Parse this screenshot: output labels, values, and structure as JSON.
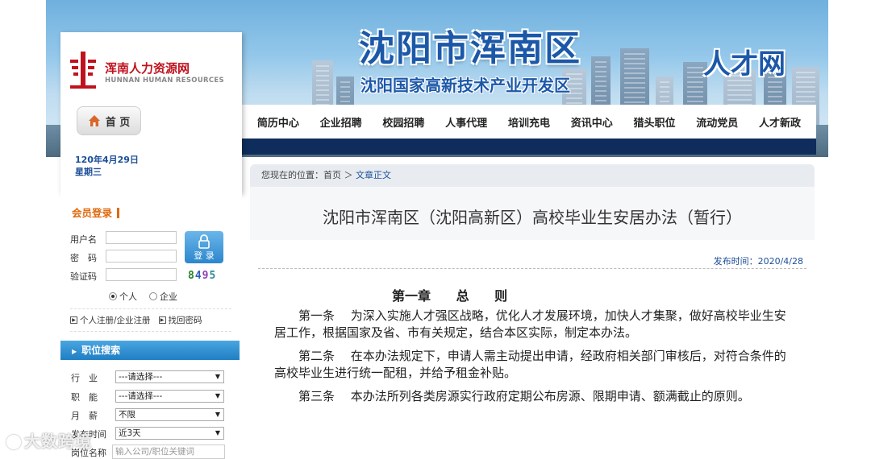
{
  "banner": {
    "district_title": "沈阳市浑南区",
    "district_sub": "沈阳国家高新技术产业开发区",
    "talent_net": "人才网"
  },
  "nav": {
    "items": [
      "简历中心",
      "企业招聘",
      "校园招聘",
      "人事代理",
      "培训充电",
      "资讯中心",
      "猎头职位",
      "流动党员",
      "人才新政"
    ]
  },
  "logo": {
    "cn": "浑南人力资源网",
    "en": "HUNNAN HUMAN RESOURCES"
  },
  "home_button": {
    "label": "首 页"
  },
  "date": {
    "line": "120年4月29日",
    "weekday": "星期三"
  },
  "member_login": {
    "title": "会员登录",
    "username_label": "用户名",
    "password_label": "密　码",
    "captcha_label": "验证码",
    "captcha_digits": [
      {
        "ch": "8",
        "color": "#2a7f2a"
      },
      {
        "ch": "4",
        "color": "#2c5fb8"
      },
      {
        "ch": "9",
        "color": "#8a3fb0"
      },
      {
        "ch": "5",
        "color": "#2a8aa0"
      }
    ],
    "login_label": "登 录",
    "radio_personal": "个人",
    "radio_company": "企业",
    "register_link": "个人注册/企业注册",
    "recover_link": "找回密码"
  },
  "job_search": {
    "title": "职位搜索",
    "fields": [
      {
        "label": "行　业",
        "value": "---请选择---"
      },
      {
        "label": "职　能",
        "value": "---请选择---"
      },
      {
        "label": "月　薪",
        "value": "不限"
      },
      {
        "label": "发布时间",
        "value": "近3天"
      }
    ],
    "keyword_label": "岗位名称",
    "keyword_placeholder": "输入公司/职位关键词"
  },
  "breadcrumb": {
    "prefix": "您现在的位置：首页 ＞ ",
    "current": "文章正文"
  },
  "article": {
    "title": "沈阳市浑南区（沈阳高新区）高校毕业生安居办法（暂行）",
    "publish_time": "发布时间：2020/4/28",
    "chapter": "第一章　 总　 则",
    "paragraphs": [
      "第一条　 为深入实施人才强区战略，优化人才发展环境，加快人才集聚，做好高校毕业生安居工作，根据国家及省、市有关规定，结合本区实际，制定本办法。",
      "第二条　 在本办法规定下，申请人需主动提出申请，经政府相关部门审核后，对符合条件的高校毕业生进行统一配租，并给予租金补贴。",
      "第三条　 本办法所列各类房源实行政府定期公布房源、限期申请、额满截止的原则。"
    ]
  },
  "watermark": "大数跨境",
  "colors": {
    "brand_blue": "#1c58a8",
    "nav_strip": "#0e2d5c",
    "accent_orange": "#e06a0d",
    "logo_red": "#c0121e"
  }
}
